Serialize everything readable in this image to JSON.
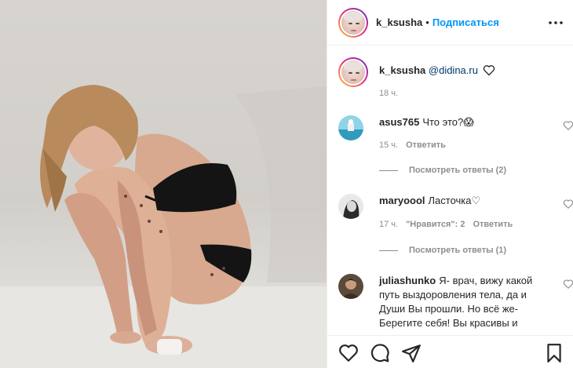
{
  "header": {
    "username": "k_ksusha",
    "separator": "•",
    "follow_label": "Подписаться",
    "more_icon": "more-horizontal-icon"
  },
  "caption": {
    "username": "k_ksusha",
    "mention": "@didina.ru",
    "time": "18 ч."
  },
  "comments": [
    {
      "username": "asus765",
      "text": "Что это?😱",
      "time": "15 ч.",
      "actions": [
        "Ответить"
      ],
      "replies_label": "Посмотреть ответы (2)"
    },
    {
      "username": "maryoool",
      "text": "Ласточка♡",
      "time": "17 ч.",
      "actions": [
        "\"Нравится\": 2",
        "Ответить"
      ],
      "replies_label": "Посмотреть ответы (1)"
    },
    {
      "username": "juliashunko",
      "text": "Я- врач, вижу какой путь выздоровления тела, да и Души Вы прошли. Но всё же- Берегите себя! Вы красивы и"
    }
  ],
  "footer": {
    "icons": [
      "heart-icon",
      "comment-icon",
      "share-icon",
      "bookmark-icon"
    ]
  },
  "colors": {
    "accent": "#0095f6",
    "text": "#262626",
    "muted": "#8e8e8e",
    "mention": "#00376b"
  }
}
